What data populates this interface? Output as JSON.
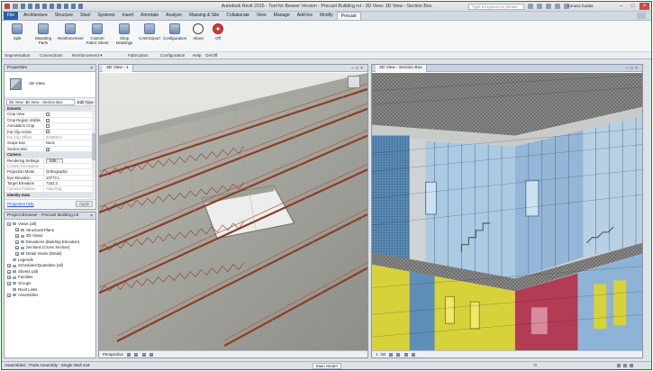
{
  "title": "Autodesk Revit 2015 - Tool for Beaver Version - Precast Building.rvt - 3D View: 3D View - Section Box",
  "search_placeholder": "Type a keyword or phrase",
  "user": "tomasz.fudala",
  "ribbon_tabs": [
    "File",
    "Architecture",
    "Structure",
    "Steel",
    "Systems",
    "Insert",
    "Annotate",
    "Analyze",
    "Massing & Site",
    "Collaborate",
    "View",
    "Manage",
    "Add-Ins",
    "Modify",
    "Precast"
  ],
  "active_tab": "Precast",
  "ribbon": {
    "buttons": [
      {
        "label": "Split",
        "icon": "split-icon"
      },
      {
        "label": "Mounting Parts",
        "icon": "mounting-parts-icon"
      },
      {
        "label": "Reinforcement",
        "icon": "reinforcement-icon"
      },
      {
        "label": "Custom Fabric Sheet",
        "icon": "fabric-sheet-icon"
      },
      {
        "label": "Shop Drawings",
        "icon": "shop-drawings-icon"
      },
      {
        "label": "CAM Export",
        "icon": "cam-export-icon"
      },
      {
        "label": "Configuration",
        "icon": "configuration-icon"
      },
      {
        "label": "About",
        "icon": "info-icon"
      },
      {
        "label": "Off",
        "icon": "power-icon"
      }
    ],
    "panels": [
      "Segmentation",
      "Connections",
      "Reinforcement ▾",
      "Fabrication",
      "Configuration",
      "Help",
      "On/Off"
    ]
  },
  "properties": {
    "header": "Properties",
    "type_name": "3D View",
    "instance_selector": "3D View: 3D View - Section Box",
    "edit_type": "Edit Type",
    "rows": [
      {
        "group": "Extents"
      },
      {
        "k": "Crop View",
        "v": "",
        "cb": "off"
      },
      {
        "k": "Crop Region Visible",
        "v": "",
        "cb": "off"
      },
      {
        "k": "Annotation Crop",
        "v": "",
        "cb": "off"
      },
      {
        "k": "Far Clip Active",
        "v": "",
        "cb": "off"
      },
      {
        "k": "Far Clip Offset",
        "v": "304800.0",
        "dim": true
      },
      {
        "k": "Scope Box",
        "v": "None"
      },
      {
        "k": "Section Box",
        "v": "",
        "cb": "on"
      },
      {
        "group": "Camera"
      },
      {
        "k": "Rendering Settings",
        "v": "Edit...",
        "btn": true
      },
      {
        "k": "Locked Orientation",
        "v": "",
        "dim": true
      },
      {
        "k": "Projection Mode",
        "v": "Orthographic"
      },
      {
        "k": "Eye Elevation",
        "v": "10773.1"
      },
      {
        "k": "Target Elevation",
        "v": "7152.3"
      },
      {
        "k": "Camera Position",
        "v": "Adjusting",
        "dim": true
      },
      {
        "group": "Identity Data"
      },
      {
        "k": "View Template",
        "v": "<None>"
      }
    ],
    "help_link": "Properties help",
    "apply": "Apply"
  },
  "browser": {
    "header": "Project Browser - Precast Building.rvt",
    "nodes": [
      {
        "label": "Views (all)",
        "depth": 0,
        "toggle": "−"
      },
      {
        "label": "Structural Plans",
        "depth": 1,
        "toggle": "+"
      },
      {
        "label": "3D Views",
        "depth": 1,
        "toggle": "+"
      },
      {
        "label": "Elevations (Building Elevation)",
        "depth": 1,
        "toggle": "+"
      },
      {
        "label": "Sections (Cross Section)",
        "depth": 1,
        "toggle": "+"
      },
      {
        "label": "Detail Views (Detail)",
        "depth": 1,
        "toggle": "+"
      },
      {
        "label": "Legends",
        "depth": 0,
        "toggle": ""
      },
      {
        "label": "Schedules/Quantities (all)",
        "depth": 0,
        "toggle": "+"
      },
      {
        "label": "Sheets (all)",
        "depth": 0,
        "toggle": "+"
      },
      {
        "label": "Families",
        "depth": 0,
        "toggle": "+"
      },
      {
        "label": "Groups",
        "depth": 0,
        "toggle": "+"
      },
      {
        "label": "Revit Links",
        "depth": 0,
        "toggle": ""
      },
      {
        "label": "Assemblies",
        "depth": 0,
        "toggle": "+"
      }
    ]
  },
  "view_left": {
    "tab": "3D View - 1",
    "bar": "Perspective"
  },
  "view_right": {
    "tab": "3D View - Section Box",
    "bar": "1 : 50"
  },
  "status": {
    "text": "Assemblies : Parts Assembly : Single Wall 418",
    "model": "Main Model",
    "zero": ":0"
  },
  "colors": {
    "file_tab": "#2b5fa8",
    "frame": "#2d6f3a",
    "off_button": "#d13a3a",
    "help_link": "#1d5cc2"
  }
}
